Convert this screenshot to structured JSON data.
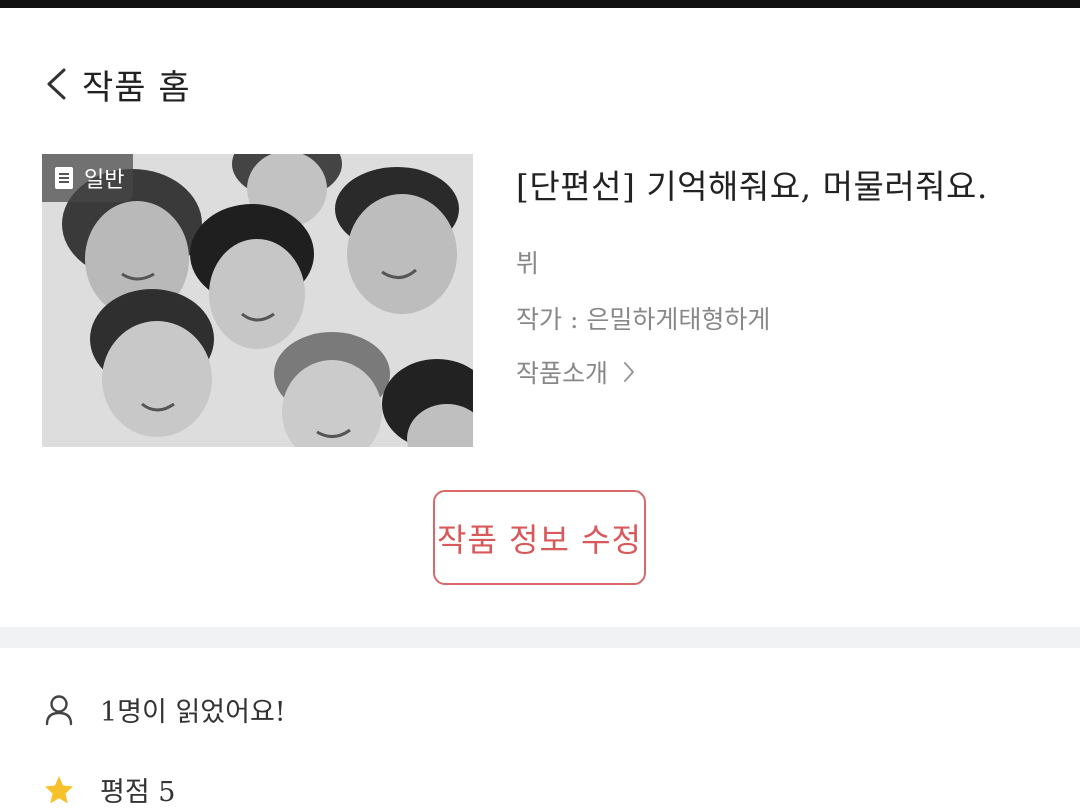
{
  "header": {
    "title": "작품 홈",
    "back_icon": "chevron-left-icon"
  },
  "cover": {
    "badge_label": "일반",
    "badge_icon": "document-icon"
  },
  "work": {
    "title": "[단편선] 기억해줘요, 머물러줘요.",
    "genre": "뷔",
    "author": "작가 : 은밀하게태형하게",
    "intro_label": "작품소개",
    "intro_icon": "chevron-right-icon"
  },
  "actions": {
    "edit_label": "작품 정보 수정"
  },
  "stats": {
    "reads_text": "1명이 읽었어요!",
    "reads_icon": "person-icon",
    "rating_text": "평점 5",
    "rating_icon": "star-icon"
  },
  "colors": {
    "accent": "#d9595b",
    "star": "#f6c12a",
    "divider": "#f1f2f4",
    "muted_text": "#888888"
  }
}
